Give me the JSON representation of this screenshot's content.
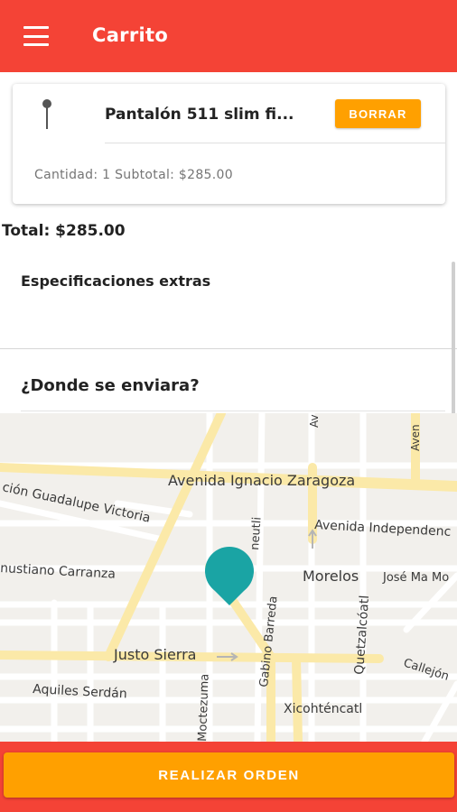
{
  "app_bar": {
    "title": "Carrito",
    "menu_icon": "hamburger-menu-icon",
    "background_color": "#f44336"
  },
  "cart": {
    "items": [
      {
        "icon": "location-pin-icon",
        "name": "Pantalón 511 slim fi...",
        "delete_label": "BORRAR",
        "meta": "Cantidad: 1 Subtotal: $285.00"
      }
    ],
    "total": "Total: $285.00"
  },
  "extras": {
    "label": "Especificaciones extras"
  },
  "delivery": {
    "label": "¿Donde se enviara?",
    "marker_icon": "map-marker-icon",
    "marker_color": "#1aa4a4"
  },
  "map": {
    "streets": {
      "zaragoza": "Avenida Ignacio Zaragoza",
      "victoria": "ción Guadalupe Victoria",
      "independencia": "Avenida Independenc",
      "carranza": "nustiano Carranza",
      "morelos": "Morelos",
      "jose_ma": "José Ma Mo",
      "barreda": "Gabino Barreda",
      "quetzalcoatl": "Quetzalcóatl",
      "justo_sierra": "Justo Sierra",
      "aquiles": "Aquiles Serdán",
      "moctezuma": "Moctezuma",
      "xicohtencatl": "Xicohténcatl",
      "callejon": "Callejón",
      "neutli": "neutli",
      "ave_top1": "Av",
      "ave_top2": "Aven"
    }
  },
  "footer": {
    "order_label": "REALIZAR ORDEN",
    "button_color": "#ffa000"
  }
}
